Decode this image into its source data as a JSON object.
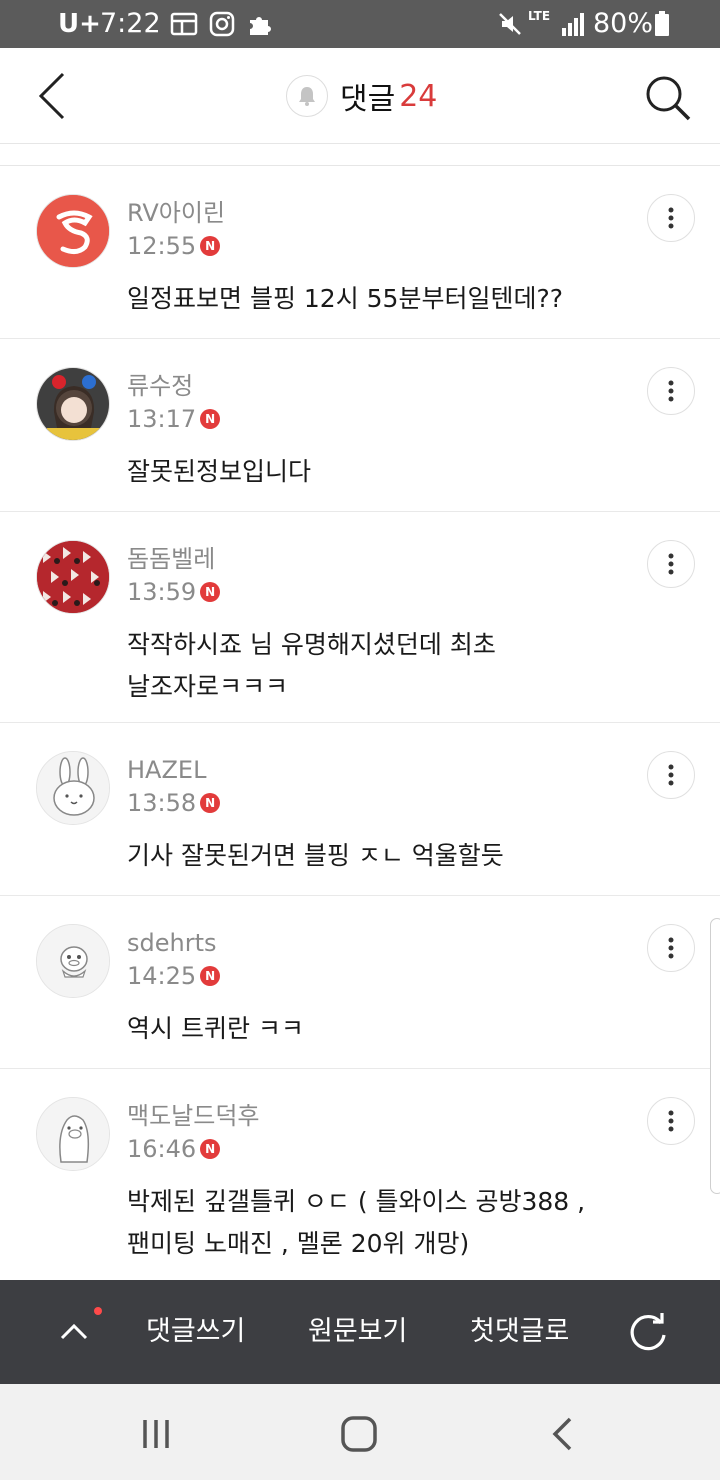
{
  "status_bar": {
    "carrier": "U+",
    "time": "7:22",
    "network": "LTE",
    "battery": "80%"
  },
  "header": {
    "title": "댓글",
    "count": "24"
  },
  "comments": [
    {
      "nickname": "RV아이린",
      "time": "12:55",
      "text": "일정표보면 블핑 12시 55분부터일텐데??",
      "avatar_color": "#e8574a"
    },
    {
      "nickname": "류수정",
      "time": "13:17",
      "text": "잘못된정보입니다",
      "avatar_color": "#3a3a3a"
    },
    {
      "nickname": "돔돔벨레",
      "time": "13:59",
      "text": "작작하시죠 님 유명해지셨던데 최초 날조자로ㅋㅋㅋ",
      "avatar_color": "#b5272d"
    },
    {
      "nickname": "HAZEL",
      "time": "13:58",
      "text": "기사 잘못된거면 블핑 ㅈㄴ 억울할듯",
      "avatar_color": "#f4f4f4"
    },
    {
      "nickname": "sdehrts",
      "time": "14:25",
      "text": "역시 트퀴란 ㅋㅋ",
      "avatar_color": "#f4f4f4"
    },
    {
      "nickname": "맥도날드덕후",
      "time": "16:46",
      "text": "박제된 깊갤틀퀴 ㅇㄷ ( 틀와이스 공방388 ,팬미팅 노매진 , 멜론 20위 개망)",
      "avatar_color": "#f4f4f4"
    }
  ],
  "new_badge": "N",
  "bottom_bar": {
    "write": "댓글쓰기",
    "original": "원문보기",
    "first": "첫댓글로"
  },
  "colors": {
    "accent_red": "#d93b3b",
    "bottom_bar_bg": "#3d3e42",
    "status_bar_bg": "#5b5b5b"
  },
  "icons": [
    "back-icon",
    "bell-icon",
    "search-icon",
    "more-icon",
    "chevron-up-icon",
    "refresh-icon",
    "recents-icon",
    "home-icon",
    "nav-back-icon"
  ]
}
